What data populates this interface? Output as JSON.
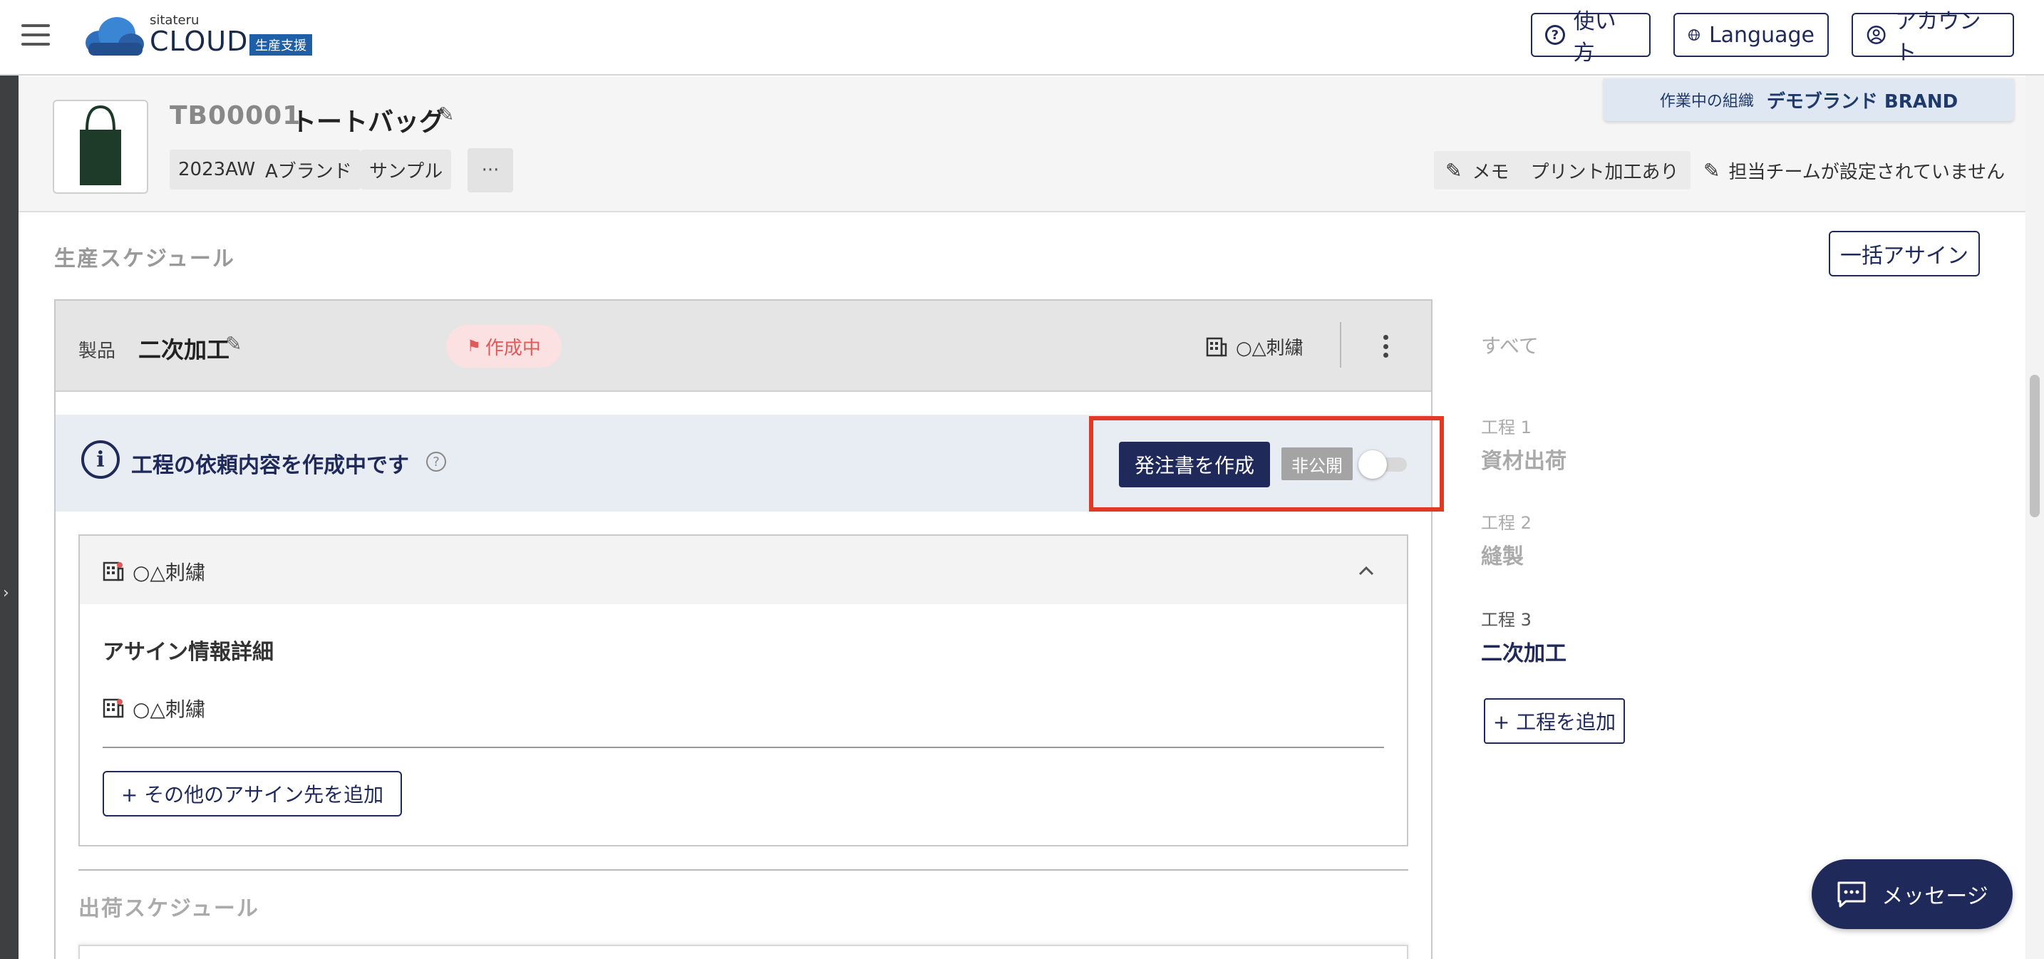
{
  "header": {
    "logo_small": "sitateru",
    "logo_main": "CLOUD",
    "logo_badge": "生産支援",
    "help_label": "使い方",
    "language_label": "Language",
    "account_label": "アカウント"
  },
  "org": {
    "label": "作業中の組織",
    "name": "デモブランド BRAND"
  },
  "product": {
    "code": "TB00001",
    "name": "トートバッグ",
    "tags": [
      "2023AW",
      "Aブランド",
      "サンプル"
    ],
    "more": "···",
    "memo_label": "メモ",
    "memo_text": "プリント加工あり",
    "team_text": "担当チームが設定されていません"
  },
  "schedule": {
    "section_title": "生産スケジュール",
    "bulk_assign": "一括アサイン",
    "card": {
      "label": "製品",
      "title": "二次加工",
      "status": "作成中",
      "factory": "○△刺繍"
    },
    "info": {
      "text": "工程の依頼内容を作成中です",
      "order_button": "発注書を作成",
      "private_label": "非公開"
    },
    "assignment": {
      "factory": "○△刺繍",
      "detail_title": "アサイン情報詳細",
      "detail_factory": "○△刺繍",
      "add_button": "+ その他のアサイン先を追加"
    },
    "shipping_title": "出荷スケジュール"
  },
  "steps_panel": {
    "all_label": "すべて",
    "steps": [
      {
        "label": "工程 1",
        "name": "資材出荷"
      },
      {
        "label": "工程 2",
        "name": "縫製"
      },
      {
        "label": "工程 3",
        "name": "二次加工"
      }
    ],
    "add_step": "+ 工程を追加"
  },
  "message_button": "メッセージ",
  "colors": {
    "primary": "#1f2a5a",
    "highlight": "#e03a24",
    "status_pill_bg": "#fbe1e1",
    "status_pill_text": "#e05a5a"
  }
}
